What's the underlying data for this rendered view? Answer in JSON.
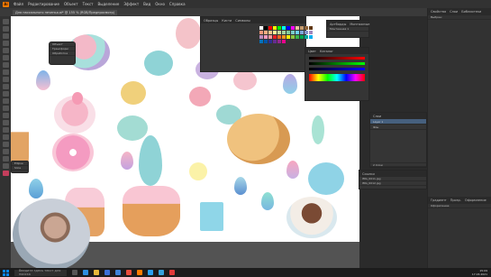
{
  "menubar": {
    "logo": "Ai",
    "items": [
      "Файл",
      "Редактирование",
      "Объект",
      "Текст",
      "Выделение",
      "Эффект",
      "Вид",
      "Окно",
      "Справка"
    ]
  },
  "control_bar": {
    "doc_tab": "Для пасхального печенья.ai* @ 155 % (RGB/Предпросмотр)"
  },
  "panels": {
    "swatches": {
      "tabs": [
        "Образцы",
        "Кисти",
        "Символы"
      ],
      "colors": [
        "#ffffff",
        "#000000",
        "#ff0000",
        "#ffff00",
        "#00ff00",
        "#00ffff",
        "#0000ff",
        "#ff00ff",
        "#e8c39e",
        "#c69c6d",
        "#8c6239",
        "#603813",
        "#f7977a",
        "#fbad82",
        "#fdc68c",
        "#fff79a",
        "#c4df9b",
        "#a3d39c",
        "#82ca9c",
        "#7accc8",
        "#6dcff6",
        "#7da7d9",
        "#8493ca",
        "#a187be",
        "#bd8cbf",
        "#f49ac1",
        "#f6989d",
        "#ed1c24",
        "#f26522",
        "#f7941d",
        "#fff200",
        "#8dc63f",
        "#39b54a",
        "#00a651",
        "#00a99d",
        "#00aeef",
        "#0072bc",
        "#0054a6",
        "#2e3192",
        "#662d91",
        "#92278f",
        "#ec008c"
      ]
    },
    "color": {
      "tabs": [
        "Цвет",
        "Каталог"
      ]
    },
    "artboards": {
      "tabs": [
        "Артборды",
        "Монтажные"
      ],
      "item": "Монтажная 1"
    },
    "layers": {
      "tabs": [
        "Слои"
      ],
      "rows": [
        "Layer 1",
        "Фон"
      ],
      "footer": "2 Слои"
    },
    "links": {
      "tabs": [
        "Ссылки"
      ],
      "items": [
        "IMG_0011.jpg",
        "IMG_0012.jpg"
      ]
    }
  },
  "right_dock": {
    "tabs": [
      "Свойства",
      "Слои",
      "Библиотеки"
    ],
    "lower_tabs": [
      "Градиент",
      "Прозр.",
      "Оформление"
    ],
    "label": "Выбран:",
    "sub": "Оформление"
  },
  "float_menu": {
    "items": [
      "Объект",
      "Трансформ",
      "Обработка"
    ]
  },
  "float_mini": {
    "items": [
      "Ellipse",
      "Slice"
    ]
  },
  "taskbar": {
    "search_placeholder": "Введите здесь текст для поиска",
    "time": "15:09",
    "date": "17.03.2021",
    "lang": "РУС"
  },
  "canvas": {
    "zoom": "155%"
  }
}
